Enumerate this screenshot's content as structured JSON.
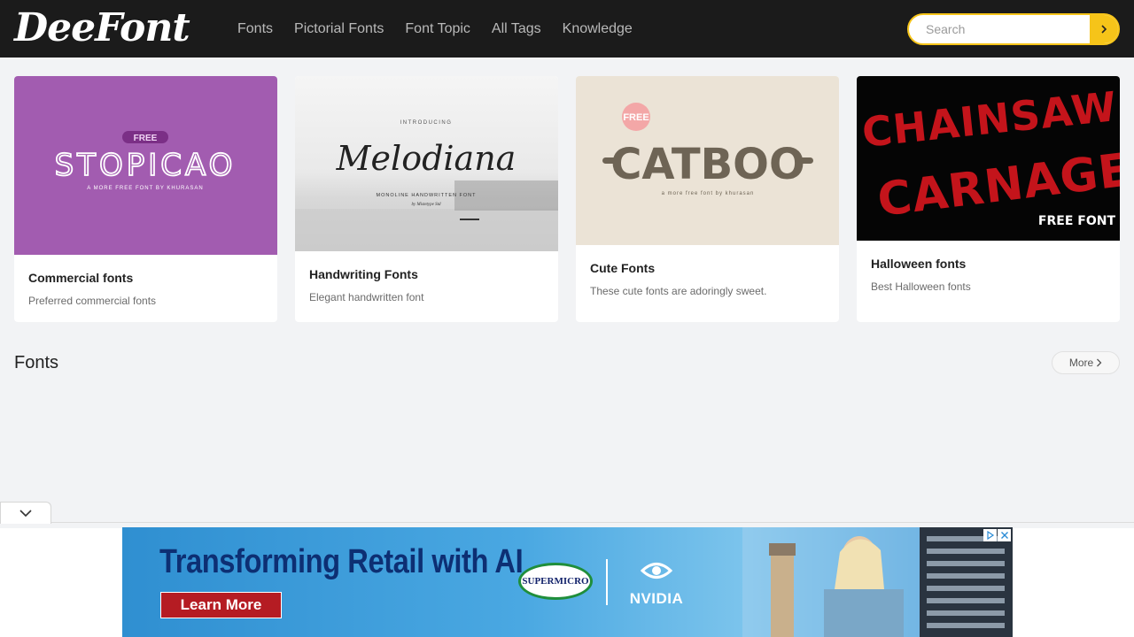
{
  "header": {
    "logo": "DeeFont",
    "nav": [
      "Fonts",
      "Pictorial Fonts",
      "Font Topic",
      "All Tags",
      "Knowledge"
    ],
    "search": {
      "placeholder": "Search",
      "value": ""
    }
  },
  "cards": [
    {
      "title": "Commercial fonts",
      "desc": "Preferred commercial fonts",
      "image": {
        "badge": "FREE",
        "name": "STOPICAO",
        "tagline": "A MORE FREE FONT BY KHURASAN"
      }
    },
    {
      "title": "Handwriting Fonts",
      "desc": "Elegant handwritten font",
      "image": {
        "intro": "INTRODUCING",
        "name": "Melodiana",
        "tagline": "MONOLINE HANDWRITTEN FONT",
        "credit": "by Mistetype Std"
      }
    },
    {
      "title": "Cute Fonts",
      "desc": "These cute fonts are adoringly sweet.",
      "image": {
        "badge": "FREE",
        "name": "CATBOO",
        "tagline": "a more free font by khurasan"
      }
    },
    {
      "title": "Halloween fonts",
      "desc": "Best Halloween fonts",
      "image": {
        "line1": "CHAINSAW",
        "line2": "CARNAGE",
        "badge": "FREE FONT"
      }
    }
  ],
  "section": {
    "title": "Fonts",
    "more_label": "More"
  },
  "ad": {
    "headline": "Transforming Retail with AI",
    "cta": "Learn More",
    "brand1": "SUPERMICRO",
    "brand2": "NVIDIA"
  },
  "colors": {
    "header_bg": "#1b1b1b",
    "accent": "#f6c419",
    "page_bg": "#f2f3f5"
  }
}
